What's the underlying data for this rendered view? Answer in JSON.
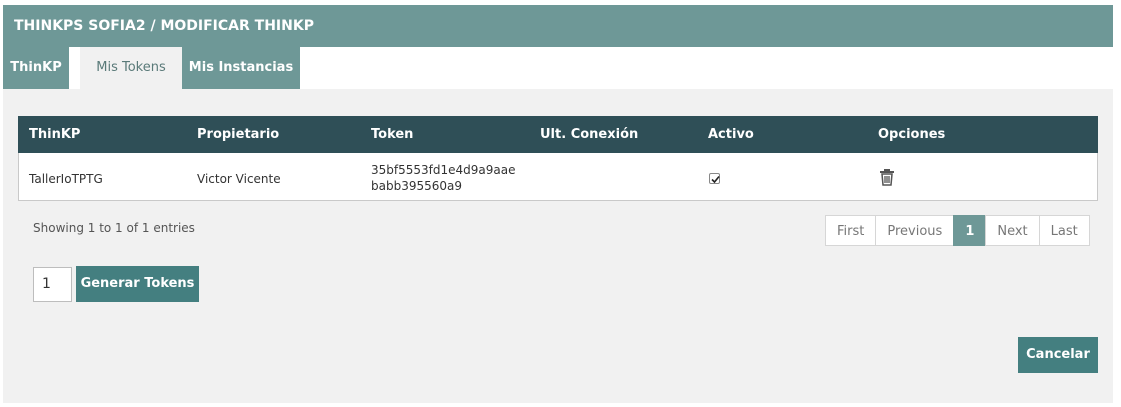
{
  "header": {
    "title": "THINKPS SOFIA2 / MODIFICAR THINKP"
  },
  "tabs": [
    {
      "label": "ThinKP"
    },
    {
      "label": "Mis Tokens"
    },
    {
      "label": "Mis Instancias"
    }
  ],
  "table": {
    "columns": [
      "ThinKP",
      "Propietario",
      "Token",
      "Ult. Conexión",
      "Activo",
      "Opciones"
    ],
    "rows": [
      {
        "thinkp": "TallerIoTPTG",
        "propietario": "Victor Vicente",
        "token_line1": "35bf5553fd1e4d9a9aae",
        "token_line2": "babb395560a9",
        "ult_conexion": "",
        "activo": true,
        "opciones_icon": "trash-icon"
      }
    ]
  },
  "pagination": {
    "info": "Showing 1 to 1 of 1 entries",
    "first": "First",
    "previous": "Previous",
    "current": "1",
    "next": "Next",
    "last": "Last"
  },
  "generate": {
    "quantity": "1",
    "button_label": "Generar Tokens"
  },
  "cancel_label": "Cancelar",
  "colors": {
    "header": "#6e9897",
    "table_header": "#2f4f57",
    "button": "#447f80"
  }
}
